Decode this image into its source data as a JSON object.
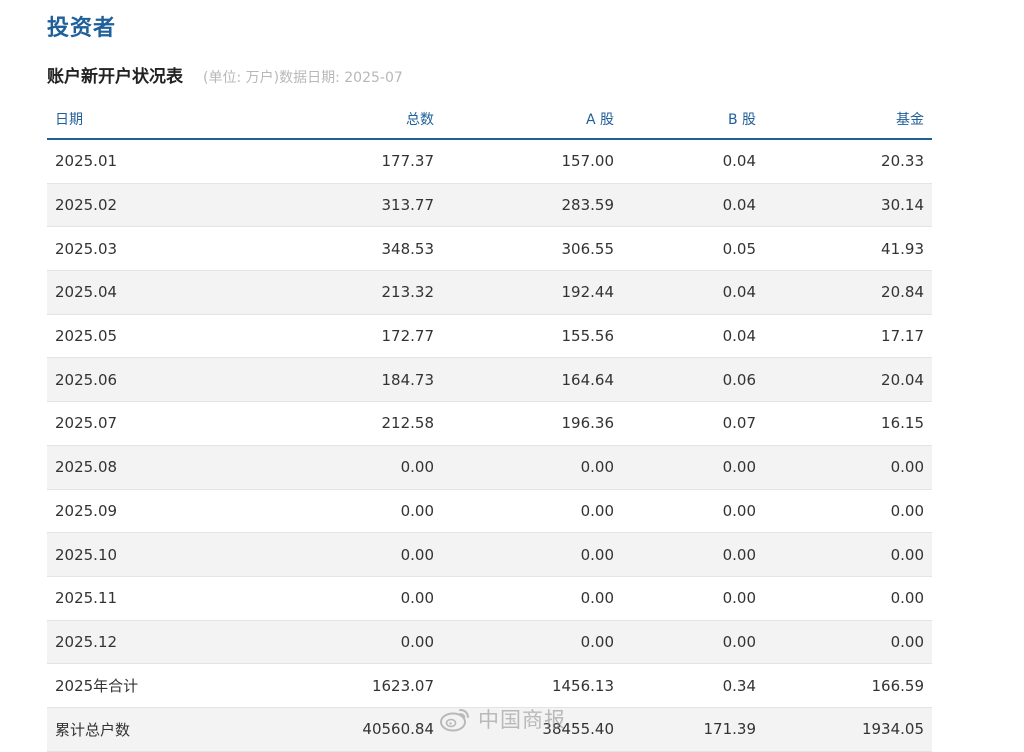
{
  "section": {
    "title": "投资者"
  },
  "table": {
    "title": "账户新开户状况表",
    "note": "(单位: 万户)数据日期: 2025-07",
    "columns": [
      "日期",
      "总数",
      "A 股",
      "B 股",
      "基金"
    ],
    "rows": [
      [
        "2025.01",
        "177.37",
        "157.00",
        "0.04",
        "20.33"
      ],
      [
        "2025.02",
        "313.77",
        "283.59",
        "0.04",
        "30.14"
      ],
      [
        "2025.03",
        "348.53",
        "306.55",
        "0.05",
        "41.93"
      ],
      [
        "2025.04",
        "213.32",
        "192.44",
        "0.04",
        "20.84"
      ],
      [
        "2025.05",
        "172.77",
        "155.56",
        "0.04",
        "17.17"
      ],
      [
        "2025.06",
        "184.73",
        "164.64",
        "0.06",
        "20.04"
      ],
      [
        "2025.07",
        "212.58",
        "196.36",
        "0.07",
        "16.15"
      ],
      [
        "2025.08",
        "0.00",
        "0.00",
        "0.00",
        "0.00"
      ],
      [
        "2025.09",
        "0.00",
        "0.00",
        "0.00",
        "0.00"
      ],
      [
        "2025.10",
        "0.00",
        "0.00",
        "0.00",
        "0.00"
      ],
      [
        "2025.11",
        "0.00",
        "0.00",
        "0.00",
        "0.00"
      ],
      [
        "2025.12",
        "0.00",
        "0.00",
        "0.00",
        "0.00"
      ],
      [
        "2025年合计",
        "1623.07",
        "1456.13",
        "0.34",
        "166.59"
      ],
      [
        "累计总户数",
        "40560.84",
        "38455.40",
        "171.39",
        "1934.05"
      ]
    ]
  },
  "watermark": {
    "text": "中国商报",
    "icon": "weibo-icon"
  }
}
